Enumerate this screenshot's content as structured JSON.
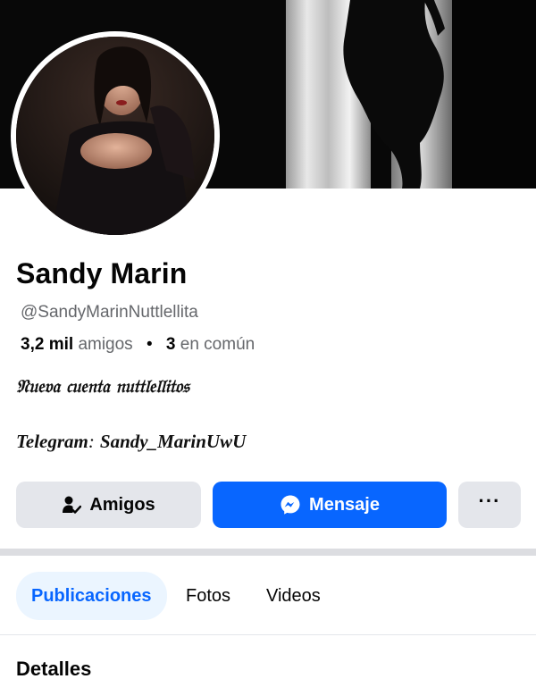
{
  "profile": {
    "name": "Sandy Marin",
    "handle": "@SandyMarinNuttlellita",
    "friends_count": "3,2 mil",
    "friends_label": "amigos",
    "dot": "•",
    "mutual_count": "3",
    "mutual_label": "en común",
    "bio_line1": "𝔑𝔲𝔢𝔳𝔞 𝔠𝔲𝔢𝔫𝔱𝔞 𝔫𝔲𝔱𝔱𝔩𝔢𝔩𝔩𝔦𝔱𝔬𝔰",
    "bio_line2_label": "Telegram",
    "bio_line2_sep": ":",
    "bio_line2_value": "Sandy_MarinUwU"
  },
  "actions": {
    "friends_label": "Amigos",
    "message_label": "Mensaje",
    "more_label": "···"
  },
  "tabs": [
    {
      "label": "Publicaciones",
      "active": true
    },
    {
      "label": "Fotos",
      "active": false
    },
    {
      "label": "Videos",
      "active": false
    }
  ],
  "section": {
    "details_title": "Detalles"
  },
  "icons": {
    "friends": "person-check-icon",
    "message": "messenger-icon",
    "more": "more-dots-icon"
  },
  "colors": {
    "primary_blue": "#0866ff",
    "tab_active_bg": "#ebf5ff",
    "button_gray": "#e4e6eb",
    "secondary_text": "#65676b"
  }
}
